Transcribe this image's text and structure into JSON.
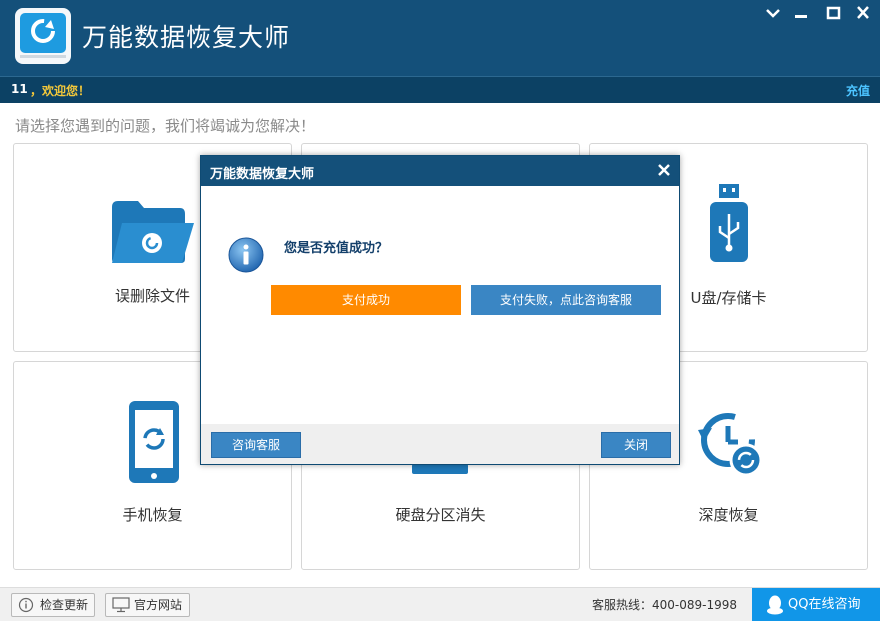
{
  "app": {
    "title": "万能数据恢复大师"
  },
  "window_controls": [
    "minimize-chevron-icon",
    "minimize-icon",
    "maximize-icon",
    "close-icon"
  ],
  "user": {
    "id": "11",
    "welcome": "，欢迎您！",
    "recharge": "充值"
  },
  "prompt": "请选择您遇到的问题，我们将竭诚为您解决！",
  "cards": [
    {
      "label": "误删除文件",
      "icon": "folder-refresh-icon"
    },
    {
      "label": "",
      "icon": "hidden-by-dialog"
    },
    {
      "label": "U盘/存储卡",
      "icon": "usb-drive-icon"
    },
    {
      "label": "手机恢复",
      "icon": "phone-refresh-icon"
    },
    {
      "label": "硬盘分区消失",
      "icon": "disk-partition-icon"
    },
    {
      "label": "深度恢复",
      "icon": "clock-refresh-icon"
    }
  ],
  "statusbar": {
    "check_update": "检查更新",
    "official_site": "官方网站",
    "hotline": "客服热线：400-089-1998",
    "qq_online": "QQ在线咨询"
  },
  "dialog": {
    "title": "万能数据恢复大师",
    "question": "您是否充值成功？",
    "success_button": "支付成功",
    "fail_button": "支付失败，点此咨询客服",
    "consult_button": "咨询客服",
    "close_button": "关闭"
  },
  "colors": {
    "titlebar": "#14507a",
    "accent_blue": "#1e78b8",
    "orange": "#ff8a00",
    "welcome_yellow": "#f4c83a",
    "recharge_blue": "#4cc3ff"
  }
}
